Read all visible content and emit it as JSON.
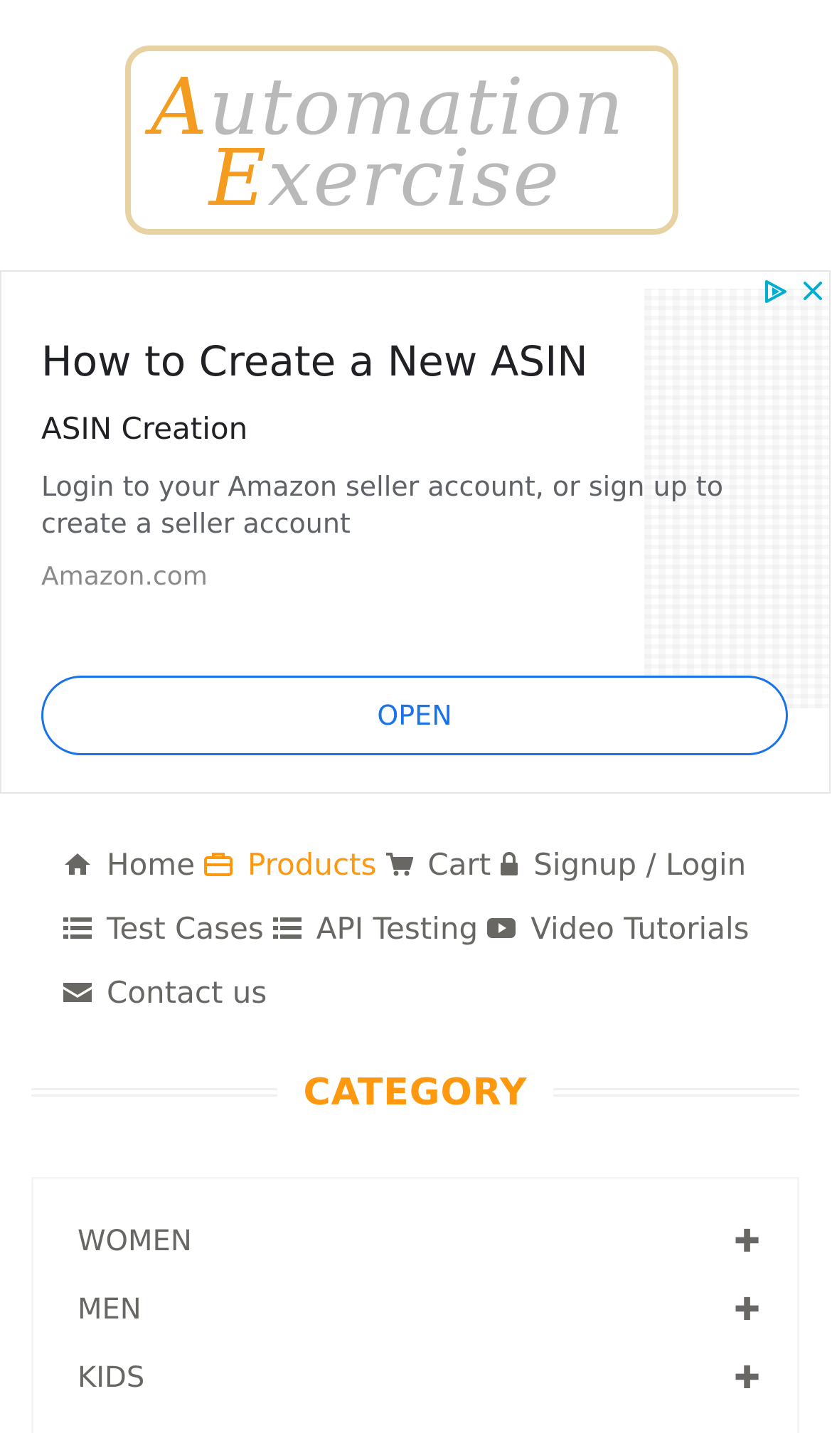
{
  "logo": {
    "line1_cap": "A",
    "line1_rest": "utomation",
    "line2_cap": "E",
    "line2_rest": "xercise",
    "colors": {
      "cap": "#f39c1f",
      "rest": "#b9b9b9",
      "border": "#e7d2a3"
    }
  },
  "ad": {
    "title": "How to Create a New ASIN",
    "subtitle": "ASIN Creation",
    "description": "Login to your Amazon seller account, or sign up to create a seller account",
    "domain": "Amazon.com",
    "button_label": "OPEN",
    "accent_color": "#1a73e8"
  },
  "nav": {
    "items": [
      {
        "label": "Home",
        "icon": "home-icon",
        "active": false
      },
      {
        "label": "Products",
        "icon": "briefcase-icon",
        "active": true
      },
      {
        "label": "Cart",
        "icon": "cart-icon",
        "active": false
      },
      {
        "label": "Signup / Login",
        "icon": "lock-icon",
        "active": false
      },
      {
        "label": "Test Cases",
        "icon": "list-icon",
        "active": false
      },
      {
        "label": "API Testing",
        "icon": "list-icon",
        "active": false
      },
      {
        "label": "Video Tutorials",
        "icon": "youtube-play-icon",
        "active": false
      },
      {
        "label": "Contact us",
        "icon": "envelope-icon",
        "active": false
      }
    ],
    "active_color": "#fe980f"
  },
  "category": {
    "title": "CATEGORY",
    "items": [
      {
        "label": "WOMEN",
        "icon": "plus-icon"
      },
      {
        "label": "MEN",
        "icon": "plus-icon"
      },
      {
        "label": "KIDS",
        "icon": "plus-icon"
      }
    ]
  }
}
